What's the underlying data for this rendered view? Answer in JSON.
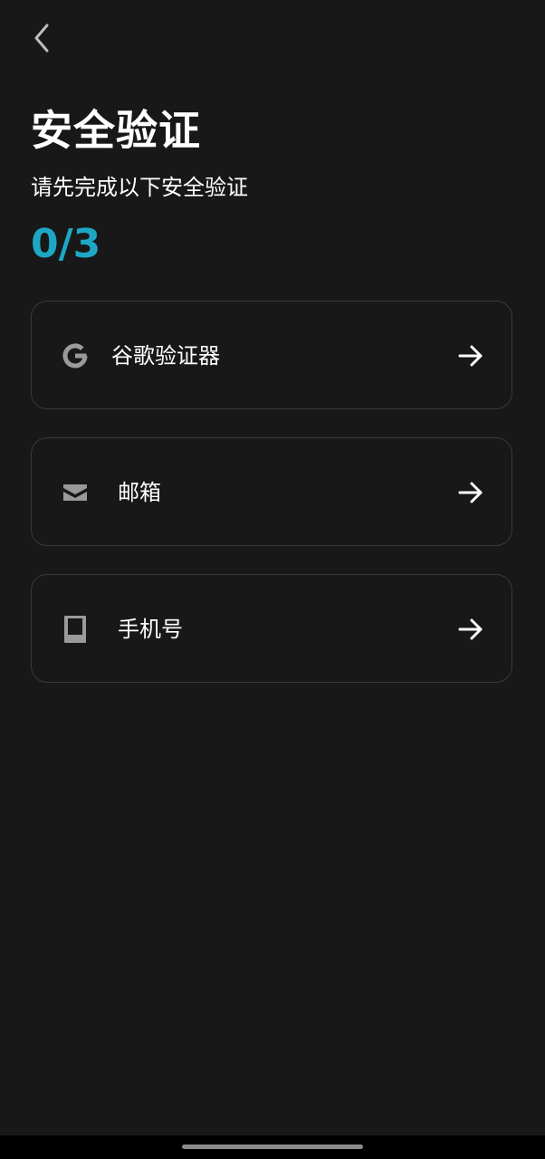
{
  "header": {
    "back_icon": "chevron-left-icon"
  },
  "page": {
    "title": "安全验证",
    "subtitle": "请先完成以下安全验证",
    "progress": "0/3"
  },
  "options": [
    {
      "label": "谷歌验证器",
      "icon": "google-icon"
    },
    {
      "label": "邮箱",
      "icon": "envelope-icon"
    },
    {
      "label": "手机号",
      "icon": "phone-icon"
    }
  ],
  "colors": {
    "background": "#181818",
    "accent": "#1ea7c5",
    "card_border": "#3a3a3a",
    "icon_gray": "#9a9a9a"
  }
}
